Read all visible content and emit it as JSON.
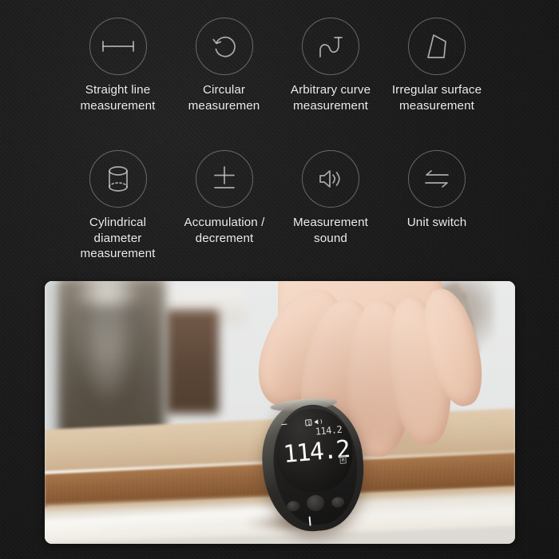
{
  "page": {
    "background_color": "#1b1b1b",
    "text_color": "#ededed",
    "accent_color": "#c9c9c9"
  },
  "features": {
    "rows": [
      {
        "items": [
          {
            "icon": "straight-line-measure-icon",
            "label": "Straight line\nmeasurement"
          },
          {
            "icon": "circular-measure-icon",
            "label": "Circular\nmeasuremen"
          },
          {
            "icon": "arbitrary-curve-icon",
            "label": "Arbitrary curve\nmeasurement"
          },
          {
            "icon": "irregular-surface-icon",
            "label": "Irregular surface\nmeasurement"
          }
        ]
      },
      {
        "items": [
          {
            "icon": "cylinder-icon",
            "label": "Cylindrical\ndiameter\nmeasurement"
          },
          {
            "icon": "plus-minus-icon",
            "label": "Accumulation /\ndecrement"
          },
          {
            "icon": "speaker-icon",
            "label": "Measurement\nsound"
          },
          {
            "icon": "unit-switch-icon",
            "label": "Unit switch"
          }
        ]
      }
    ]
  },
  "photo": {
    "alt": "Hand holding a small oval laser distance measuring device on the edge of a wooden table",
    "device": {
      "display": {
        "status_dash": "-",
        "bluetooth_icon": "bluetooth-icon",
        "sound_icon": "speaker-icon",
        "secondary_value": "114.2",
        "primary_value": "114.2",
        "unit_badge": "m"
      },
      "buttons": [
        "left-button",
        "center-button",
        "right-button"
      ],
      "bottom_indicator": "measure-tick"
    },
    "scene": {
      "wall": "#e6e7e7",
      "table_top": "#d9c3a4",
      "table_edge": "#96653c",
      "floor": "#f0ece4"
    }
  }
}
